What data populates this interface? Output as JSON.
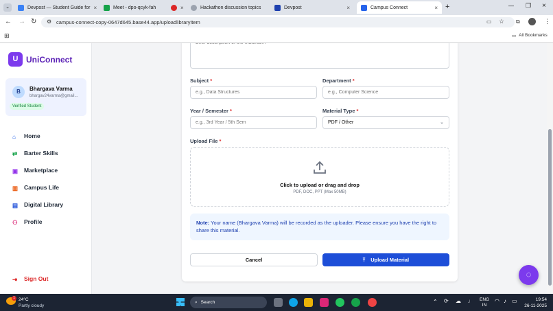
{
  "tabs": [
    {
      "label": "Devpost — Student Guide for",
      "color": "#3b82f6"
    },
    {
      "label": "Meet - dpo-qcyk-fah",
      "color": "#16a34a"
    },
    {
      "label": "",
      "color": "#dc2626"
    },
    {
      "label": "Hackathon discussion topics",
      "color": "#9ca3af"
    },
    {
      "label": "Devpost",
      "color": "#1e40af"
    },
    {
      "label": "Campus Connect",
      "color": "#2563eb"
    }
  ],
  "url": "campus-connect-copy-0647d645.base44.app/uploadlibraryitem",
  "bookmarks": "All Bookmarks",
  "app": {
    "logo_letter": "U",
    "name": "UniConnect"
  },
  "user": {
    "initial": "B",
    "name": "Bhargava Varma",
    "email": "bhargav24varma@gmail...",
    "badge": "Verified Student"
  },
  "nav": [
    "Home",
    "Barter Skills",
    "Marketplace",
    "Campus Life",
    "Digital Library",
    "Profile"
  ],
  "signout": "Sign Out",
  "form": {
    "description_placeholder": "Brief description of the material...",
    "subject_label": "Subject",
    "subject_placeholder": "e.g., Data Structures",
    "department_label": "Department",
    "department_placeholder": "e.g., Computer Science",
    "year_label": "Year / Semester",
    "year_placeholder": "e.g., 3rd Year / 5th Sem",
    "type_label": "Material Type",
    "type_value": "PDF / Other",
    "upload_label": "Upload File",
    "upload_title": "Click to upload or drag and drop",
    "upload_hint": "PDF, DOC, PPT (Max 50MB)",
    "note_bold": "Note:",
    "note_text": "Your name (Bhargava Varma) will be recorded as the uploader. Please ensure you have the right to share this material.",
    "cancel": "Cancel",
    "submit": "Upload Material",
    "required_mark": "*"
  },
  "taskbar": {
    "temp": "24°C",
    "weather": "Partly cloudy",
    "search": "Search",
    "lang1": "ENG",
    "lang2": "IN",
    "time": "19:54",
    "date": "26-11-2025",
    "weather_badge": "1"
  },
  "colors": {
    "brand": "#7c3aed",
    "primary": "#1d4ed8",
    "note_bg": "#eff6ff"
  }
}
